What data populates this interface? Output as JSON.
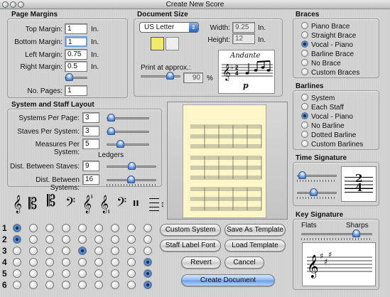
{
  "window": {
    "title": "Create New Score"
  },
  "page_margins": {
    "heading": "Page Margins",
    "top_label": "Top Margin:",
    "top_value": "1",
    "bottom_label": "Bottom Margin:",
    "bottom_value": "1",
    "left_label": "Left Margin:",
    "left_value": "0.75",
    "right_label": "Right Margin:",
    "right_value": "0.5",
    "unit": "In.",
    "pages_label": "No. Pages:",
    "pages_value": "1"
  },
  "document_size": {
    "heading": "Document Size",
    "paper": "US Letter",
    "width_label": "Width:",
    "width_value": "9.25",
    "height_label": "Height:",
    "height_value": "12",
    "unit": "In.",
    "print_label": "Print at approx.:",
    "print_value": "90",
    "print_unit": "%",
    "preview_tempo": "Andante",
    "preview_dynamic": "p"
  },
  "braces": {
    "heading": "Braces",
    "options": [
      "Piano Brace",
      "Straight Brace",
      "Vocal - Piano",
      "Barline Brace",
      "No Brace",
      "Custom Braces"
    ],
    "selected": 2
  },
  "barlines": {
    "heading": "Barlines",
    "options": [
      "System",
      "Each Staff",
      "Vocal - Piano",
      "No Barline",
      "Dotted Barline",
      "Custom Barlines"
    ],
    "selected": 2
  },
  "system_layout": {
    "heading": "System and Staff Layout",
    "systems_label": "Systems Per Page:",
    "systems_value": "3",
    "staves_label": "Staves Per System:",
    "staves_value": "3",
    "measures_label": "Measures Per System:",
    "measures_value": "5",
    "ledgers_label": "Ledgers",
    "dist_staves_label": "Dist. Between Staves:",
    "dist_staves_value": "9",
    "dist_systems_label": "Dist. Between Systems:",
    "dist_systems_value": "16"
  },
  "clef_grid": {
    "row_labels": [
      "1",
      "2",
      "3",
      "4",
      "5",
      "6"
    ],
    "selected_columns": [
      0,
      0,
      4,
      8,
      8,
      8
    ],
    "overflow_glyph": "↕"
  },
  "time_signature": {
    "heading": "Time Signature",
    "top": "2",
    "bottom": "4"
  },
  "key_signature": {
    "heading": "Key Signature",
    "flats_label": "Flats",
    "sharps_label": "Sharps"
  },
  "buttons": {
    "custom_system": "Custom System",
    "save_template": "Save As Template",
    "staff_font": "Staff Label Font",
    "load_template": "Load Template",
    "revert": "Revert",
    "cancel": "Cancel",
    "create": "Create Document"
  },
  "colors": {
    "accent": "#2f63b8",
    "preview_paper": "#fcf6c8"
  }
}
